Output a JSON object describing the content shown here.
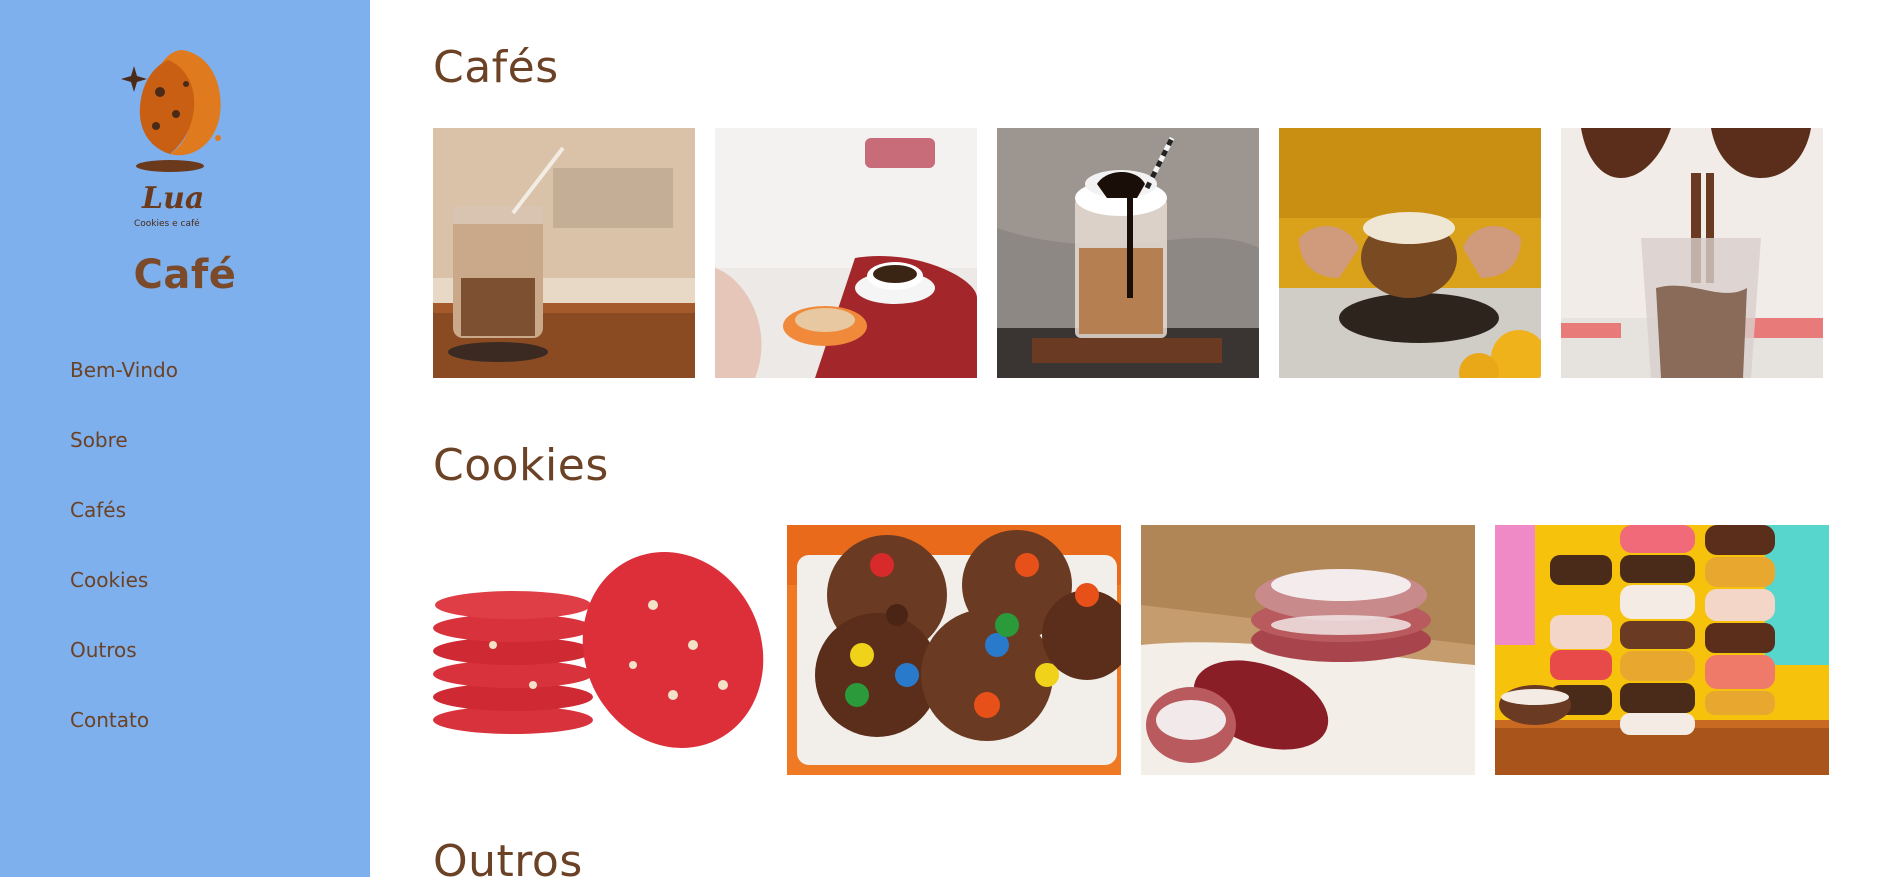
{
  "sidebar": {
    "logo": {
      "name": "Lua",
      "tagline": "Cookies e café",
      "icon": "cookie-moon-logo"
    },
    "title": "Café",
    "nav": [
      {
        "label": "Bem-Vindo"
      },
      {
        "label": "Sobre"
      },
      {
        "label": "Cafés"
      },
      {
        "label": "Cookies"
      },
      {
        "label": "Outros"
      },
      {
        "label": "Contato"
      }
    ]
  },
  "sections": {
    "cafes": {
      "title": "Cafés",
      "images": [
        "iced-latte-jar-photo",
        "cappuccino-table-photo",
        "frappe-chocolate-photo",
        "coffee-cup-hands-photo",
        "coffee-pour-glass-photo"
      ]
    },
    "cookies": {
      "title": "Cookies",
      "images": [
        "red-velvet-cookies-photo",
        "chocolate-candy-cookies-photo",
        "crinkle-cookies-photo",
        "ice-cream-cookie-sandwiches-photo"
      ]
    },
    "outros": {
      "title": "Outros"
    }
  },
  "colors": {
    "sidebar_bg": "#7eb0ee",
    "brown_text": "#6b4226",
    "logo_orange": "#e07a1f"
  }
}
